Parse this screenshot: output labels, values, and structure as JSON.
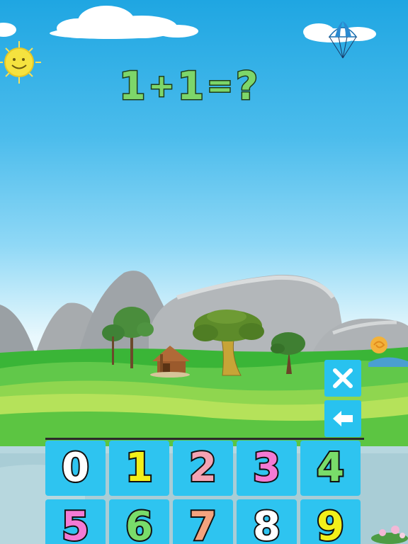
{
  "equation": {
    "operand_a": "1",
    "operator": "+",
    "operand_b": "1",
    "equals": "=",
    "unknown": "?"
  },
  "controls": {
    "clear_icon": "close-icon",
    "backspace_icon": "arrow-left-icon"
  },
  "keypad": {
    "keys": [
      {
        "label": "0",
        "color": "#ffffff"
      },
      {
        "label": "1",
        "color": "#f2ef1a"
      },
      {
        "label": "2",
        "color": "#f4a3b3"
      },
      {
        "label": "3",
        "color": "#f47ad4"
      },
      {
        "label": "4",
        "color": "#79dc6a"
      },
      {
        "label": "5",
        "color": "#f47ad4"
      },
      {
        "label": "6",
        "color": "#79dc6a"
      },
      {
        "label": "7",
        "color": "#f4a37e"
      },
      {
        "label": "8",
        "color": "#ffffff"
      },
      {
        "label": "9",
        "color": "#f2ef1a"
      }
    ],
    "key_background": "#2ec4f0"
  },
  "colors": {
    "equation_fill": "#7dd66a",
    "control_button": "#28c2ef"
  }
}
